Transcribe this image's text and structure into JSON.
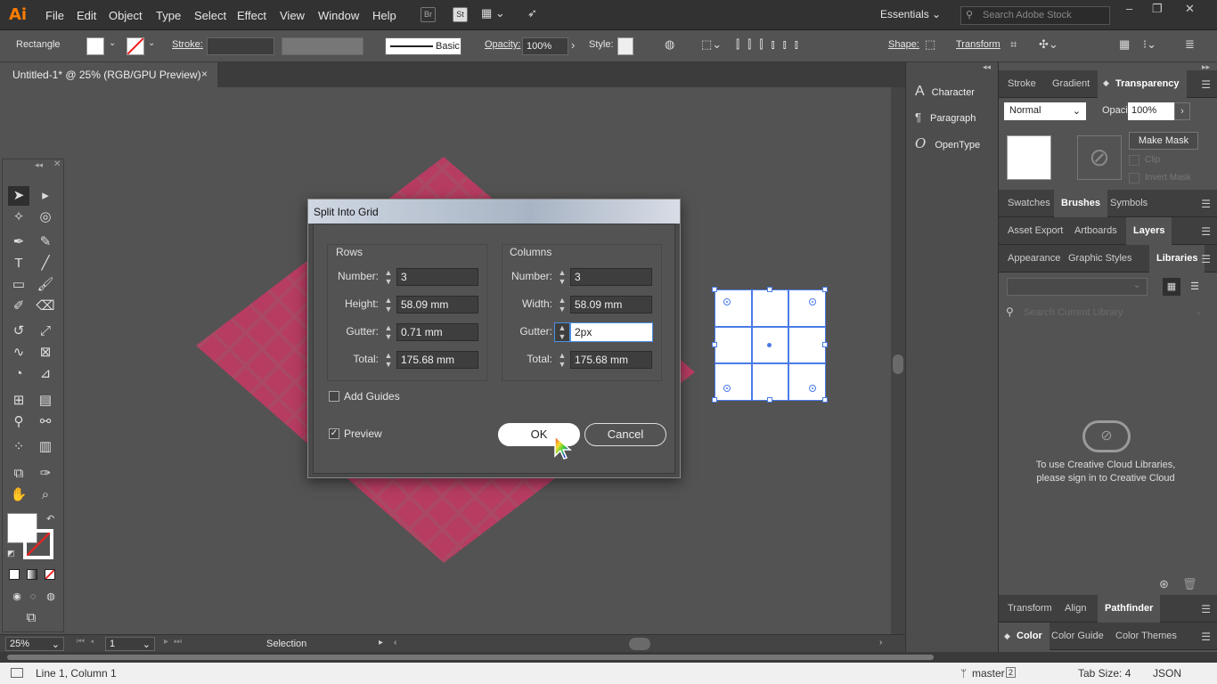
{
  "app": {
    "logo": "Ai"
  },
  "menu": [
    "File",
    "Edit",
    "Object",
    "Type",
    "Select",
    "Effect",
    "View",
    "Window",
    "Help"
  ],
  "menubar_icons": {
    "br": "Br",
    "st": "St"
  },
  "workspace": "Essentials",
  "stock_search": {
    "placeholder": "Search Adobe Stock"
  },
  "control": {
    "selection_type": "Rectangle",
    "stroke_label": "Stroke:",
    "brush": "Basic",
    "opacity_label": "Opacity:",
    "opacity_value": "100%",
    "style_label": "Style:",
    "shape_label": "Shape:",
    "transform_label": "Transform"
  },
  "document_tab": {
    "title": "Untitled-1* @ 25% (RGB/GPU Preview)",
    "close": "×"
  },
  "status": {
    "zoom": "25%",
    "artboard": "1",
    "tool": "Selection"
  },
  "dock": [
    "Character",
    "Paragraph",
    "OpenType"
  ],
  "panels": {
    "row1": [
      "Stroke",
      "Gradient",
      "Transparency"
    ],
    "transparency": {
      "blend": "Normal",
      "opacity_label": "Opacity:",
      "opacity": "100%",
      "make_mask": "Make Mask",
      "clip": "Clip",
      "invert": "Invert Mask"
    },
    "row2": [
      "Swatches",
      "Brushes",
      "Symbols"
    ],
    "row3": [
      "Asset Export",
      "Artboards",
      "Layers"
    ],
    "row4": [
      "Appearance",
      "Graphic Styles",
      "Libraries"
    ],
    "library_search": "Search Current Library",
    "cc_message_1": "To use Creative Cloud Libraries,",
    "cc_message_2": "please sign in to Creative Cloud",
    "row5": [
      "Transform",
      "Align",
      "Pathfinder"
    ],
    "row6": [
      "Color",
      "Color Guide",
      "Color Themes"
    ]
  },
  "dialog": {
    "title": "Split Into Grid",
    "rows": {
      "label": "Rows",
      "number_label": "Number:",
      "number": "3",
      "height_label": "Height:",
      "height": "58.09 mm",
      "gutter_label": "Gutter:",
      "gutter": "0.71 mm",
      "total_label": "Total:",
      "total": "175.68 mm"
    },
    "columns": {
      "label": "Columns",
      "number_label": "Number:",
      "number": "3",
      "width_label": "Width:",
      "width": "58.09 mm",
      "gutter_label": "Gutter:",
      "gutter": "2px",
      "total_label": "Total:",
      "total": "175.68 mm"
    },
    "add_guides": "Add Guides",
    "preview": "Preview",
    "ok": "OK",
    "cancel": "Cancel"
  },
  "editor_status": {
    "position": "Line 1, Column 1",
    "branch": "master",
    "branch_count": "2",
    "tab_size": "Tab Size: 4",
    "language": "JSON"
  }
}
